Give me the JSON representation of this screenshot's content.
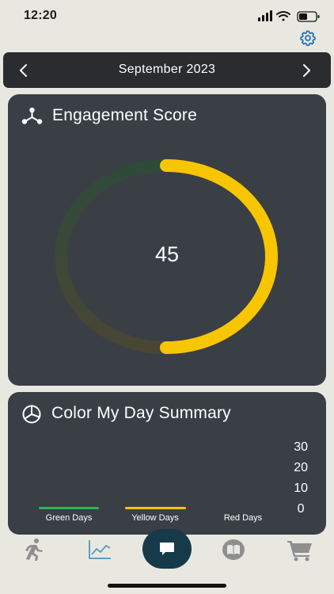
{
  "status": {
    "time": "12:20"
  },
  "header": {
    "month": "September 2023"
  },
  "engagement": {
    "title": "Engagement Score",
    "score": "45",
    "score_fraction": 0.45,
    "colors": {
      "progress": "#f7c600",
      "track_start": "#2f4a3a",
      "track_end": "#4a4634"
    }
  },
  "summary": {
    "title": "Color My Day Summary",
    "y_ticks": [
      "30",
      "20",
      "10",
      "0"
    ],
    "legend": [
      {
        "label": "Green Days",
        "color": "#2fb45a"
      },
      {
        "label": "Yellow Days",
        "color": "#f7c600"
      },
      {
        "label": "Red Days",
        "color": "#3a3e45"
      }
    ]
  },
  "tabs": [
    "running-icon",
    "chart-icon",
    "chat-icon",
    "book-icon",
    "cart-icon"
  ]
}
